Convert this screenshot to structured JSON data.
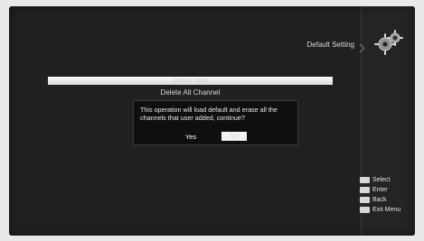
{
  "header": {
    "menu_title": "Default Setting",
    "menu_icon": "gears-icon"
  },
  "menu": {
    "items": [
      {
        "label": "Default Value"
      },
      {
        "label": "Delete All Channel"
      }
    ]
  },
  "dialog": {
    "message": "This operation will load default and erase all the channels that user added, continue?",
    "yes_label": "Yes",
    "no_label": "No"
  },
  "help": {
    "items": [
      {
        "label": "Select",
        "icon": "select-key-icon"
      },
      {
        "label": "Enter",
        "icon": "ok-key-icon"
      },
      {
        "label": "Back",
        "icon": "back-key-icon"
      },
      {
        "label": "Exit Menu",
        "icon": "exit-key-icon"
      }
    ]
  },
  "colors": {
    "tv_background": "#202020",
    "dialog_background": "#0f0f0f",
    "highlight": "#f2f2f2"
  }
}
